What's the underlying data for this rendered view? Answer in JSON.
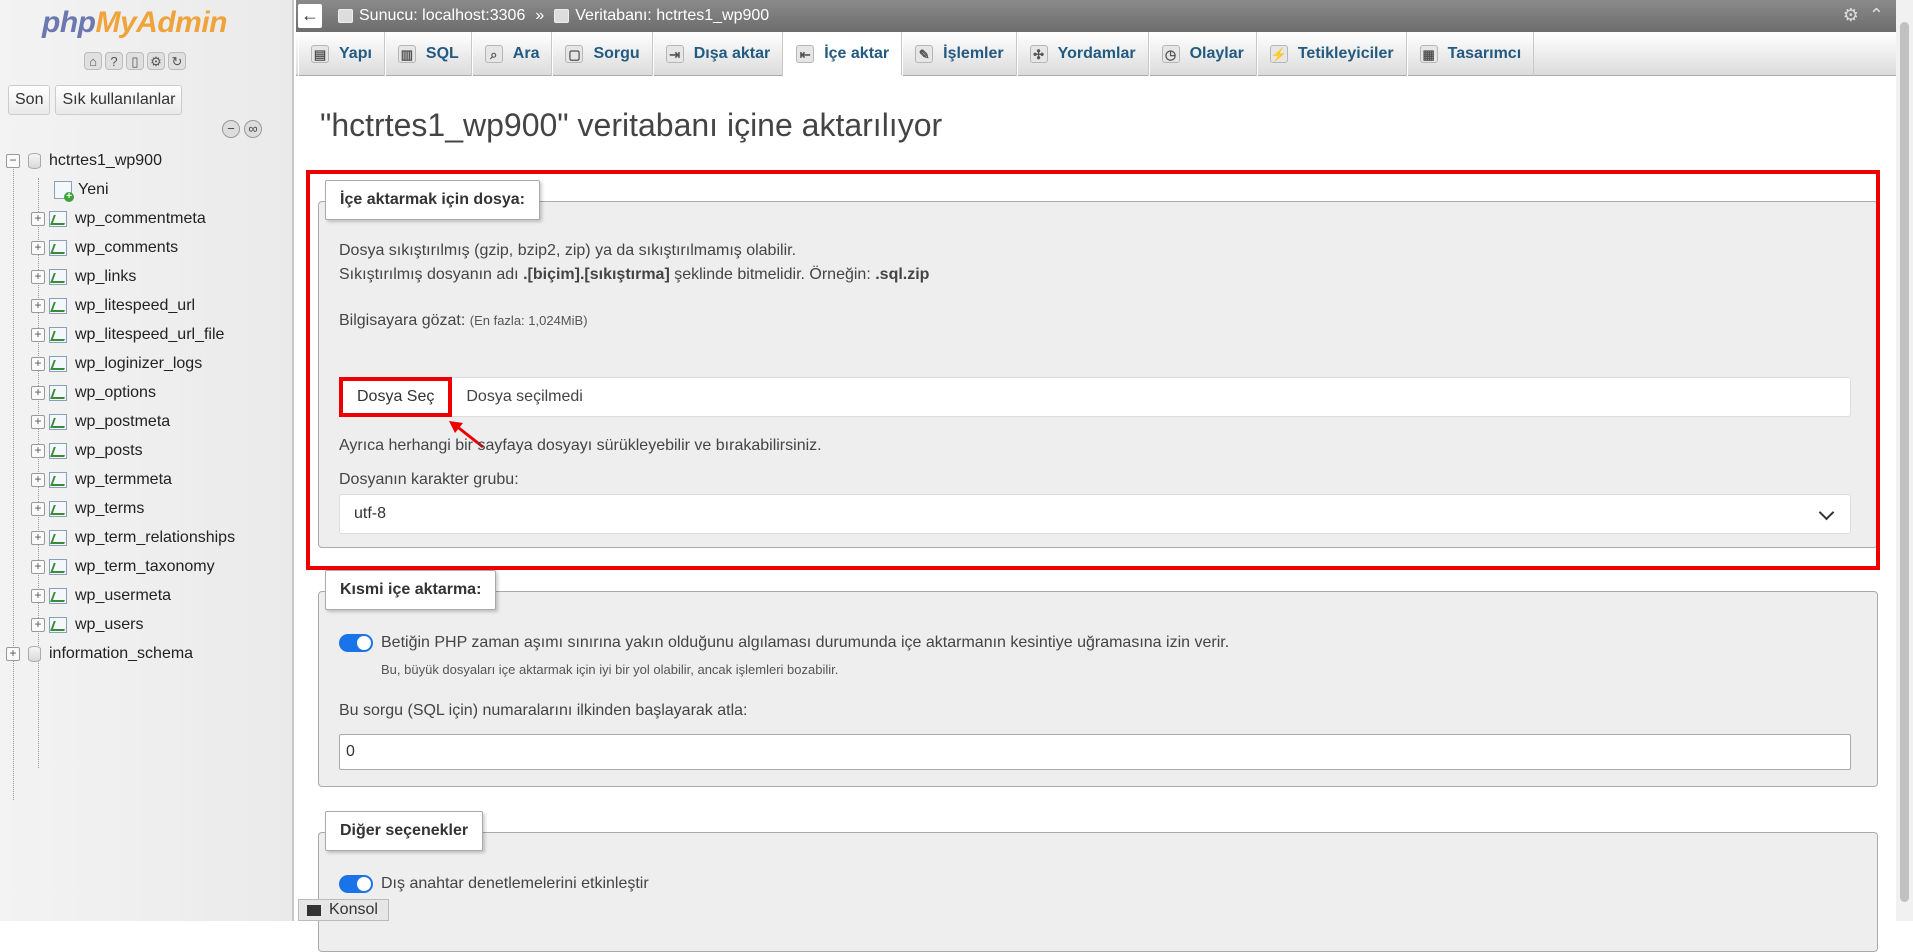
{
  "nav": {
    "logo_php": "php",
    "logo_myadmin": "MyAdmin",
    "icons": [
      "home-icon",
      "info-icon",
      "docs-icon",
      "settings-icon",
      "reload-icon"
    ],
    "tabs": [
      "Son",
      "Sık kullanılanlar"
    ],
    "tree": {
      "database": "hctrtes1_wp900",
      "new_label": "Yeni",
      "tables": [
        "wp_commentmeta",
        "wp_comments",
        "wp_links",
        "wp_litespeed_url",
        "wp_litespeed_url_file",
        "wp_loginizer_logs",
        "wp_options",
        "wp_postmeta",
        "wp_posts",
        "wp_termmeta",
        "wp_terms",
        "wp_term_relationships",
        "wp_term_taxonomy",
        "wp_usermeta",
        "wp_users"
      ],
      "other_db": "information_schema"
    }
  },
  "topbar": {
    "server": "Sunucu: localhost:3306",
    "separator": "»",
    "database": "Veritabanı: hctrtes1_wp900"
  },
  "tabs": [
    {
      "label": "Yapı",
      "icon": "structure-icon"
    },
    {
      "label": "SQL",
      "icon": "sql-icon"
    },
    {
      "label": "Ara",
      "icon": "search-icon"
    },
    {
      "label": "Sorgu",
      "icon": "query-icon"
    },
    {
      "label": "Dışa aktar",
      "icon": "export-icon"
    },
    {
      "label": "İçe aktar",
      "icon": "import-icon",
      "active": true
    },
    {
      "label": "İşlemler",
      "icon": "wrench-icon"
    },
    {
      "label": "Yordamlar",
      "icon": "routines-icon"
    },
    {
      "label": "Olaylar",
      "icon": "clock-icon"
    },
    {
      "label": "Tetikleyiciler",
      "icon": "triggers-icon"
    },
    {
      "label": "Tasarımcı",
      "icon": "designer-icon"
    }
  ],
  "main": {
    "title": "\"hctrtes1_wp900\" veritabanı içine aktarılıyor",
    "file_section": {
      "legend": "İçe aktarmak için dosya:",
      "line1": "Dosya sıkıştırılmış (gzip, bzip2, zip) ya da sıkıştırılmamış olabilir.",
      "line2_pre": "Sıkıştırılmış dosyanın adı ",
      "line2_bold": ".[biçim].[sıkıştırma]",
      "line2_mid": " şeklinde bitmelidir. Örneğin: ",
      "line2_example": ".sql.zip",
      "browse_label": "Bilgisayara gözat:",
      "max_size": "(En fazla: 1,024MiB)",
      "choose_file": "Dosya Seç",
      "no_file": "Dosya seçilmedi",
      "drag_hint": "Ayrıca herhangi bir sayfaya dosyayı sürükleyebilir ve bırakabilirsiniz.",
      "charset_label": "Dosyanın karakter grubu:",
      "charset_value": "utf-8"
    },
    "partial_section": {
      "legend": "Kısmi içe aktarma:",
      "toggle_label": "Betiğin PHP zaman aşımı sınırına yakın olduğunu algılaması durumunda içe aktarmanın kesintiye uğramasına izin verir.",
      "toggle_on": true,
      "toggle_hint": "Bu, büyük dosyaları içe aktarmak için iyi bir yol olabilir, ancak işlemleri bozabilir.",
      "skip_label": "Bu sorgu (SQL için) numaralarını ilkinden başlayarak atla:",
      "skip_value": "0"
    },
    "other_section": {
      "legend": "Diğer seçenekler",
      "fk_label": "Dış anahtar denetlemelerini etkinleştir",
      "fk_on": true
    }
  },
  "console": {
    "label": "Konsol"
  },
  "colors": {
    "accent": "#235a81",
    "highlight": "#e00000",
    "toggle": "#1a73e8"
  }
}
